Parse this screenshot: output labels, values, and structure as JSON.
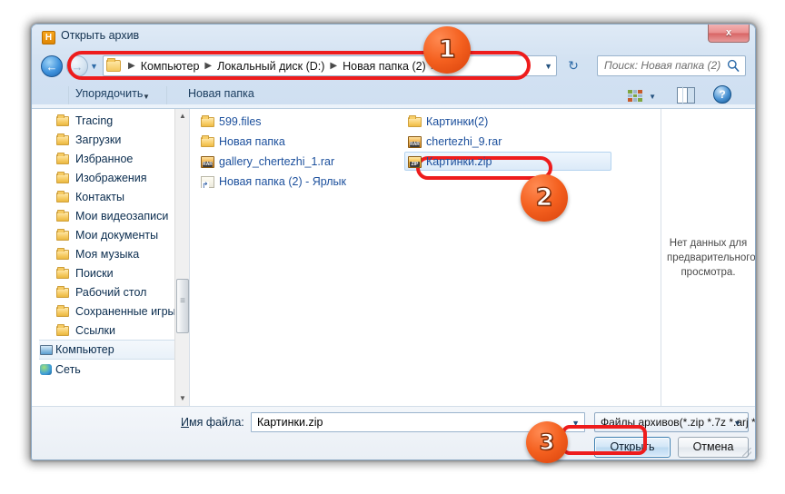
{
  "window": {
    "title": "Открыть архив",
    "app_icon": "H",
    "close_label": "x",
    "close_icon": "close-icon"
  },
  "nav": {
    "back_icon": "←",
    "forward_icon": "→",
    "history_caret": "▼",
    "refresh_icon": "↻",
    "breadcrumbs": [
      "Компьютер",
      "Локальный диск (D:)",
      "Новая папка (2)"
    ],
    "separator": "▶",
    "address_caret": "▼"
  },
  "search": {
    "placeholder": "Поиск: Новая папка (2)",
    "icon": "search-icon"
  },
  "toolbar": {
    "organize": "Упорядочить",
    "organize_caret": "▼",
    "new_folder": "Новая папка",
    "views_icon": "views-grid-icon",
    "views_caret": "▼",
    "preview_icon": "preview-pane-icon",
    "help_icon": "?"
  },
  "sidebar": {
    "items": [
      {
        "label": "Tracing",
        "icon": "folder-icon",
        "root": false,
        "selected": false
      },
      {
        "label": "Загрузки",
        "icon": "folder-download-icon",
        "root": false,
        "selected": false
      },
      {
        "label": "Избранное",
        "icon": "folder-star-icon",
        "root": false,
        "selected": false
      },
      {
        "label": "Изображения",
        "icon": "folder-pictures-icon",
        "root": false,
        "selected": false
      },
      {
        "label": "Контакты",
        "icon": "folder-contacts-icon",
        "root": false,
        "selected": false
      },
      {
        "label": "Мои видеозаписи",
        "icon": "folder-video-icon",
        "root": false,
        "selected": false
      },
      {
        "label": "Мои документы",
        "icon": "folder-documents-icon",
        "root": false,
        "selected": false
      },
      {
        "label": "Моя музыка",
        "icon": "folder-music-icon",
        "root": false,
        "selected": false
      },
      {
        "label": "Поиски",
        "icon": "folder-search-icon",
        "root": false,
        "selected": false
      },
      {
        "label": "Рабочий стол",
        "icon": "folder-desktop-icon",
        "root": false,
        "selected": false
      },
      {
        "label": "Сохраненные игры",
        "icon": "folder-games-icon",
        "root": false,
        "selected": false
      },
      {
        "label": "Ссылки",
        "icon": "folder-links-icon",
        "root": false,
        "selected": false
      },
      {
        "label": "Компьютер",
        "icon": "computer-icon",
        "root": true,
        "selected": true
      },
      {
        "label": "Сеть",
        "icon": "network-icon",
        "root": true,
        "selected": false
      }
    ],
    "scrollbar": {
      "up_arrow": "▲",
      "down_arrow": "▼"
    }
  },
  "files": {
    "column1": [
      {
        "name": "599.files",
        "icon": "folder-icon",
        "type": "folder",
        "selected": false
      },
      {
        "name": "Новая папка",
        "icon": "folder-icon",
        "type": "folder",
        "selected": false
      },
      {
        "name": "gallery_chertezhi_1.rar",
        "icon": "rar-archive-icon",
        "type": "rar",
        "selected": false
      },
      {
        "name": "Новая папка (2) - Ярлык",
        "icon": "shortcut-icon",
        "type": "shortcut",
        "selected": false
      }
    ],
    "column2": [
      {
        "name": "Картинки(2)",
        "icon": "folder-icon",
        "type": "folder",
        "selected": false
      },
      {
        "name": "chertezhi_9.rar",
        "icon": "rar-archive-icon",
        "type": "rar",
        "selected": false
      },
      {
        "name": "Картинки.zip",
        "icon": "zip-archive-icon",
        "type": "zip",
        "selected": true
      }
    ],
    "rar_badge": "RAR",
    "zip_badge": "ZIP"
  },
  "preview": {
    "message": "Нет данных для предварительного просмотра."
  },
  "footer": {
    "filename_label_prefix": "И",
    "filename_label_rest": "мя файла:",
    "filename_value": "Картинки.zip",
    "filename_caret": "▼",
    "filter_value": "Файлы архивов(*.zip *.7z *.arj *",
    "filter_caret": "▼",
    "open_button": "Открыть",
    "cancel_button": "Отмена"
  },
  "annotations": {
    "badges": [
      "1",
      "2",
      "3"
    ],
    "ring_color": "#ee1c1c",
    "badge_color": "#f4601f"
  }
}
